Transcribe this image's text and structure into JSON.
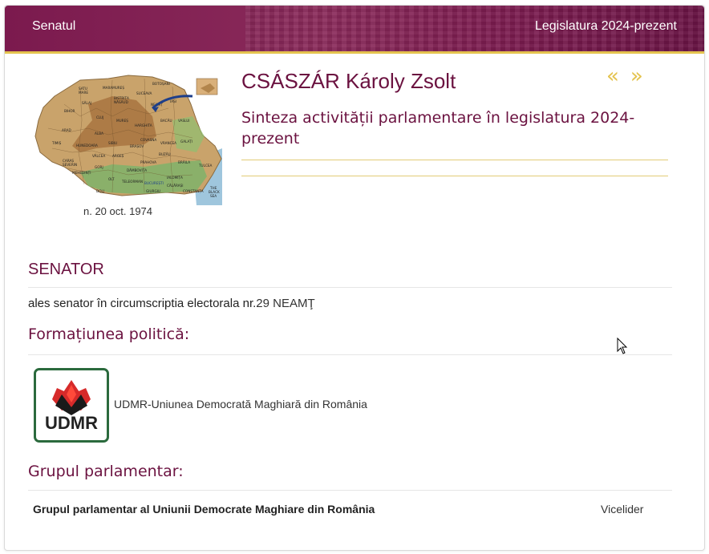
{
  "header": {
    "left_title": "Senatul",
    "right_title": "Legislatura 2024-prezent"
  },
  "profile": {
    "name": "CSÁSZÁR Károly Zsolt",
    "subtitle": "Sinteza activității parlamentare în legislatura 2024-prezent",
    "birth": "n. 20 oct. 1974",
    "prev_icon": "«",
    "next_icon": "»"
  },
  "map": {
    "labels": [
      "SATU MARE",
      "MARAMUREȘ",
      "BOTOȘANI",
      "SUCEAVA",
      "SĂLAJ",
      "BISTRIȚA NĂSĂUD",
      "IAȘI",
      "NEAMȚ",
      "BIHOR",
      "CLUJ",
      "MUREȘ",
      "HARGHITA",
      "BACĂU",
      "VASLUI",
      "ARAD",
      "ALBA",
      "COVASNA",
      "VRANCEA",
      "GALAȚI",
      "TIMIȘ",
      "HUNEDOARA",
      "SIBIU",
      "BRAȘOV",
      "BUZĂU",
      "CARAȘ SEVERIN",
      "VÂLCEA",
      "ARGEȘ",
      "PRAHOVA",
      "BRĂILA",
      "TULCEA",
      "MEHEDINȚI",
      "GORJ",
      "DÂMBOVIȚA",
      "IALOMIȚA",
      "OLT",
      "TELEORMAN",
      "GIURGIU",
      "CĂLĂRAȘI",
      "CONSTANȚA",
      "DOLJ",
      "BUCUREȘTI",
      "BLACK SEA"
    ],
    "colors": {
      "land": "#c9a36b",
      "mountain": "#a8743f",
      "lowland": "#7fb36a",
      "sea": "#9fc6dd",
      "arrow": "#1e3f8a"
    }
  },
  "senator_section": {
    "title": "SENATOR",
    "elected_prefix": "ales senator în circumscriptia electorala nr.",
    "circumscription": "29 NEAMŢ"
  },
  "party_section": {
    "title": "Formațiunea politică:",
    "logo_text": "UDMR",
    "party_name": "UDMR-Uniunea Democrată Maghiară din România"
  },
  "group_section": {
    "title": "Grupul parlamentar:",
    "group_name": "Grupul parlamentar al Uniunii Democrate Maghiare din România",
    "role": "Vicelider"
  },
  "colors": {
    "brand": "#7b1a4e",
    "accent_gold": "#e4c34e",
    "heading": "#6b1240",
    "udmr_green": "#2b6a3d",
    "udmr_red": "#d62a2a"
  }
}
